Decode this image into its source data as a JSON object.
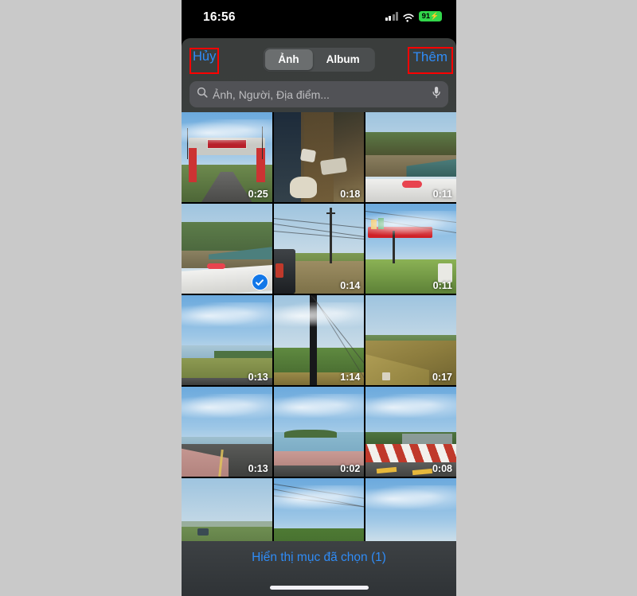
{
  "background_color": "#c9c9c9",
  "status_bar": {
    "time": "16:56",
    "battery_percent": "91",
    "battery_color": "#32d74b",
    "charging_bolt": "⚡",
    "icons": [
      "cellular-signal-icon",
      "wifi-icon",
      "battery-icon"
    ]
  },
  "nav": {
    "cancel_label": "Hủy",
    "add_label": "Thêm",
    "accent_color": "#2f8cf7",
    "annotation_color": "#ff0000",
    "segmented": {
      "options": [
        "Ảnh",
        "Album"
      ],
      "selected": "Ảnh"
    }
  },
  "search": {
    "placeholder": "Ảnh, Người, Địa điểm...",
    "search_icon": "search-icon",
    "mic_icon": "microphone-icon"
  },
  "grid": {
    "selected_count": 1,
    "items": [
      {
        "scene": "gate-road",
        "duration": "0:25",
        "selected": false
      },
      {
        "scene": "tree-dark",
        "duration": "0:18",
        "selected": false
      },
      {
        "scene": "river-valley",
        "duration": "0:11",
        "selected": false
      },
      {
        "scene": "bridge-rail",
        "duration": "",
        "selected": true
      },
      {
        "scene": "field-poles",
        "duration": "0:14",
        "selected": false
      },
      {
        "scene": "red-gate-field",
        "duration": "0:11",
        "selected": false
      },
      {
        "scene": "lake-shore",
        "duration": "0:13",
        "selected": false
      },
      {
        "scene": "pole-close",
        "duration": "1:14",
        "selected": false
      },
      {
        "scene": "dry-hill",
        "duration": "0:17",
        "selected": false
      },
      {
        "scene": "causeway",
        "duration": "0:13",
        "selected": false
      },
      {
        "scene": "island-water",
        "duration": "0:02",
        "selected": false
      },
      {
        "scene": "dam-barrier",
        "duration": "0:08",
        "selected": false
      },
      {
        "scene": "hills-far",
        "duration": "",
        "selected": false
      },
      {
        "scene": "forest-wires",
        "duration": "",
        "selected": false
      },
      {
        "scene": "sea-horizon",
        "duration": "",
        "selected": false
      }
    ]
  },
  "bottom_bar": {
    "show_selected_label": "Hiển thị mục đã chọn (1)",
    "accent_color": "#2f8cf7"
  }
}
